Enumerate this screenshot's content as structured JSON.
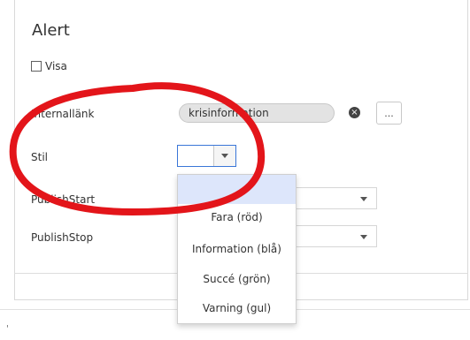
{
  "panel": {
    "title": "Alert"
  },
  "visa": {
    "label": "Visa",
    "checked": false
  },
  "internal_link": {
    "label": "Internallänk",
    "value": "krisinformation",
    "clear_icon": "clear-circle-x-icon",
    "browse_label": "..."
  },
  "stil": {
    "label": "Stil",
    "selected_value": "",
    "options": [
      "",
      "Fara (röd)",
      "Information (blå)",
      "Succé (grön)",
      "Varning (gul)"
    ]
  },
  "publish_start": {
    "label": "PublishStart",
    "value": ""
  },
  "publish_stop": {
    "label": "PublishStop",
    "value": ""
  },
  "colors": {
    "focus_border": "#3a76d8",
    "selected_option_bg": "#dde6fb",
    "annotation_red": "#e3151a",
    "pill_bg": "#e3e3e3"
  },
  "misc": {
    "bottom_mark": "'"
  }
}
